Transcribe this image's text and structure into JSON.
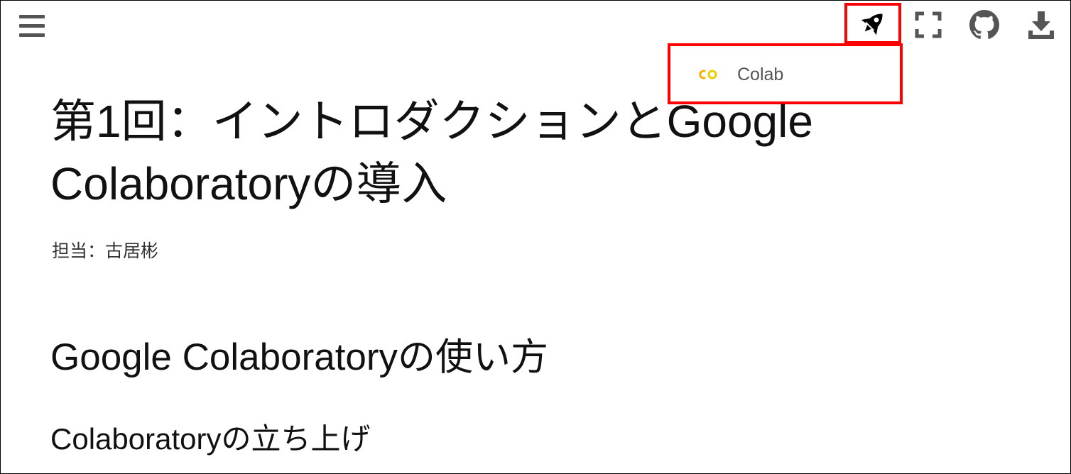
{
  "topbar": {
    "menu_icon": "hamburger-menu-icon",
    "launch_icon": "rocket-icon",
    "fullscreen_icon": "fullscreen-icon",
    "github_icon": "github-icon",
    "download_icon": "download-icon"
  },
  "launch_menu": {
    "items": [
      {
        "label": "Colab",
        "icon": "colab-logo-icon"
      }
    ]
  },
  "content": {
    "title": "第1回：イントロダクションとGoogle Colaboratoryの導入",
    "author": "担当：古居彬",
    "section_heading": "Google Colaboratoryの使い方",
    "subsection_heading": "Colaboratoryの立ち上げ"
  },
  "colors": {
    "highlight": "#ff0000",
    "icon_gray": "#555555",
    "colab_logo": "#f9ab00"
  }
}
